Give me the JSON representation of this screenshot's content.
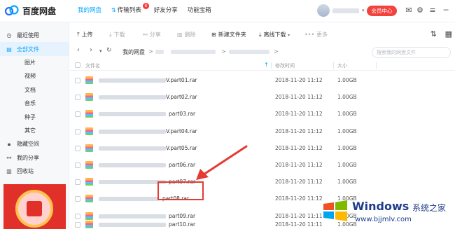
{
  "app": {
    "title": "百度网盘"
  },
  "nav": {
    "tabs": [
      {
        "label": "我的网盘",
        "active": true
      },
      {
        "label": "传输列表",
        "badge": "8"
      },
      {
        "label": "好友分享"
      },
      {
        "label": "功能宝箱"
      }
    ]
  },
  "header": {
    "vip_label": "会员中心"
  },
  "sidebar": {
    "items": [
      {
        "label": "最近使用",
        "icon": "clock-icon"
      },
      {
        "label": "全部文件",
        "icon": "folder-icon",
        "active": true
      },
      {
        "label": "图片"
      },
      {
        "label": "视频"
      },
      {
        "label": "文档"
      },
      {
        "label": "音乐"
      },
      {
        "label": "种子"
      },
      {
        "label": "其它"
      },
      {
        "label": "隐藏空间",
        "icon": "lock-icon"
      },
      {
        "label": "我的分享",
        "icon": "share-icon"
      },
      {
        "label": "回收站",
        "icon": "trash-icon"
      }
    ]
  },
  "toolbar": {
    "upload": "上传",
    "download": "下载",
    "share": "分享",
    "delete": "删除",
    "new_folder": "新建文件夹",
    "offline_download": "离线下载",
    "more": "更多"
  },
  "breadcrumb": {
    "root": "我的网盘",
    "separator": ">"
  },
  "search": {
    "placeholder": "搜索我的网盘文件"
  },
  "table": {
    "headers": {
      "name": "文件名",
      "modified": "修改时间",
      "size": "大小"
    },
    "rows": [
      {
        "name": "V.part01.rar",
        "modified": "2018-11-20 11:12",
        "size": "1.00GB"
      },
      {
        "name": "V.part02.rar",
        "modified": "2018-11-20 11:12",
        "size": "1.00GB"
      },
      {
        "name": "part03.rar",
        "modified": "2018-11-20 11:12",
        "size": "1.00GB"
      },
      {
        "name": "V.part04.rar",
        "modified": "2018-11-20 11:12",
        "size": "1.00GB"
      },
      {
        "name": "V.part05.rar",
        "modified": "2018-11-20 11:12",
        "size": "1.00GB"
      },
      {
        "name": "part06.rar",
        "modified": "2018-11-20 11:12",
        "size": "1.00GB"
      },
      {
        "name": "part07.rar",
        "modified": "2018-11-20 11:12",
        "size": "1.00GB"
      },
      {
        "name": "part08.rar",
        "modified": "2018-11-20 11:12",
        "size": "1.00GB"
      },
      {
        "name": "part09.rar",
        "modified": "2018-11-20 11:11",
        "size": "1.00GB"
      },
      {
        "name": "part10.rar",
        "modified": "2018-11-20 11:11",
        "size": "1.00GB"
      }
    ]
  },
  "watermark": {
    "title": "Windows",
    "subtitle": "系统之家",
    "url": "www.bjjmlv.com"
  },
  "colors": {
    "accent": "#06a7ff",
    "vip": "#f3433e",
    "highlight": "#e33a32"
  }
}
